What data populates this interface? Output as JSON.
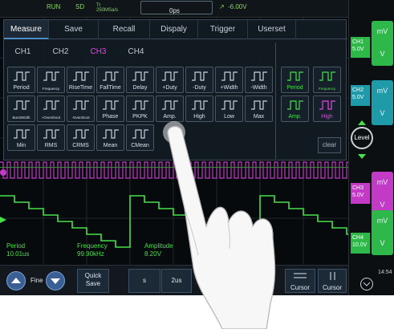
{
  "status": {
    "run": "RUN",
    "sd": "SD",
    "sample": "Tr\n250MSa/s",
    "time": "0ps",
    "trigger": "-6.00V"
  },
  "menu_tabs": [
    "Measure",
    "Save",
    "Recall",
    "Dispaly",
    "Trigger",
    "Userset"
  ],
  "active_tab": "Measure",
  "channel_tabs": [
    "CH1",
    "CH2",
    "CH3",
    "CH4"
  ],
  "active_channel": "CH3",
  "measurements": [
    {
      "label": "Period",
      "icon": "period-icon",
      "tiny": false
    },
    {
      "label": "Frequency",
      "icon": "frequency-icon",
      "tiny": true
    },
    {
      "label": "RiseTime",
      "icon": "rise-time-icon",
      "tiny": false
    },
    {
      "label": "FallTime",
      "icon": "fall-time-icon",
      "tiny": false
    },
    {
      "label": "Delay",
      "icon": "delay-icon",
      "tiny": false
    },
    {
      "label": "+Duty",
      "icon": "positive-duty-icon",
      "tiny": false
    },
    {
      "label": "-Duty",
      "icon": "negative-duty-icon",
      "tiny": false
    },
    {
      "label": "+Width",
      "icon": "positive-width-icon",
      "tiny": false
    },
    {
      "label": "-Width",
      "icon": "negative-width-icon",
      "tiny": false
    },
    {
      "label": "BurstWidth",
      "icon": "burst-width-icon",
      "tiny": true
    },
    {
      "label": "+Overshoot",
      "icon": "positive-overshoot-icon",
      "tiny": true
    },
    {
      "label": "-Overshoot",
      "icon": "negative-overshoot-icon",
      "tiny": true
    },
    {
      "label": "Phase",
      "icon": "phase-icon",
      "tiny": false
    },
    {
      "label": "PKPK",
      "icon": "pkpk-icon",
      "tiny": false
    },
    {
      "label": "Amp.",
      "icon": "amplitude-icon",
      "tiny": false
    },
    {
      "label": "High",
      "icon": "high-icon",
      "tiny": false
    },
    {
      "label": "Low",
      "icon": "low-icon",
      "tiny": false
    },
    {
      "label": "Max",
      "icon": "max-icon",
      "tiny": false
    },
    {
      "label": "Min",
      "icon": "min-icon",
      "tiny": false
    },
    {
      "label": "RMS",
      "icon": "rms-icon",
      "tiny": false
    },
    {
      "label": "CRMS",
      "icon": "crms-icon",
      "tiny": false
    },
    {
      "label": "Mean",
      "icon": "mean-icon",
      "tiny": false
    },
    {
      "label": "CMean",
      "icon": "cmean-icon",
      "tiny": false
    }
  ],
  "selected": [
    {
      "label": "Period",
      "color": "green",
      "tiny": false
    },
    {
      "label": "Frequency",
      "color": "green",
      "tiny": true
    },
    {
      "label": "Amp.",
      "color": "green",
      "tiny": false
    },
    {
      "label": "High",
      "color": "magenta",
      "tiny": false
    }
  ],
  "clear_label": "clear",
  "channels": [
    {
      "name": "CH1",
      "scale": "5.0V",
      "color": "#2fb84a"
    },
    {
      "name": "CH2",
      "scale": "5.0V",
      "color": "#1e9aa8"
    },
    {
      "name": "CH3",
      "scale": "5.0V",
      "color": "#c33ac6"
    },
    {
      "name": "CH4",
      "scale": "10.0V",
      "color": "#2fb84a"
    }
  ],
  "volt_buttons": [
    {
      "unit": "mV",
      "label": "V",
      "color": "#2fb84a"
    },
    {
      "unit": "mV",
      "label": "V",
      "color": "#1e9aa8"
    },
    {
      "unit": "mV",
      "label": "V",
      "color": "#c33ac6"
    },
    {
      "unit": "mV",
      "label": "V",
      "color": "#2fb84a"
    }
  ],
  "level_label": "Level",
  "readouts": [
    {
      "name": "Period",
      "value": "10.01us"
    },
    {
      "name": "Frequency",
      "value": "99.90kHz"
    },
    {
      "name": "Amplitude",
      "value": "8.20V"
    }
  ],
  "bottom": {
    "fine": "Fine",
    "quick_save": "Quick\nSave",
    "s": "s",
    "timebase": "2us",
    "cursor1": "Cursor",
    "cursor2": "Cursor",
    "clock": "14:54"
  },
  "colors": {
    "green": "#47e04a",
    "magenta": "#e544e8",
    "cyan": "#1e9aa8"
  }
}
